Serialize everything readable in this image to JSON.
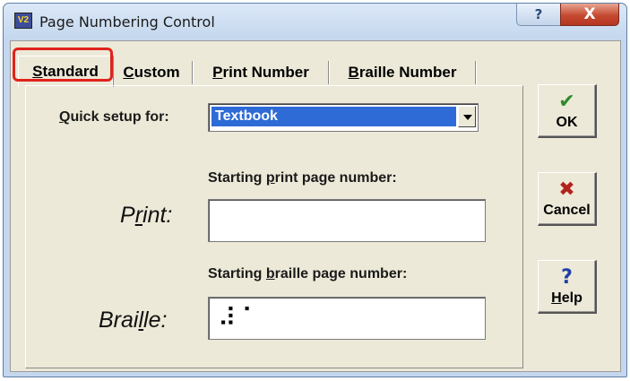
{
  "window": {
    "title": "Page Numbering Control",
    "app_icon": "V2",
    "help_glyph": "?",
    "close_glyph": "X"
  },
  "tabs": [
    {
      "label": "Standard",
      "mnemonic": "S",
      "rest": "tandard",
      "active": true
    },
    {
      "label": "Custom",
      "mnemonic": "C",
      "rest": "ustom",
      "active": false
    },
    {
      "label": "Print Number",
      "mnemonic": "P",
      "rest": "rint Number",
      "active": false
    },
    {
      "label": "Braille Number",
      "mnemonic": "B",
      "rest": "raille Number",
      "active": false
    }
  ],
  "quick_setup": {
    "label_mnemonic": "Q",
    "label_rest": "uick setup for:",
    "selected": "Textbook"
  },
  "print": {
    "heading_pre": "Starting ",
    "heading_mnemonic": "p",
    "heading_post": "rint page number:",
    "label_pre": "P",
    "label_mnemonic": "r",
    "label_post": "int:",
    "value": ""
  },
  "braille": {
    "heading_pre": "Starting ",
    "heading_mnemonic": "b",
    "heading_post": "raille page number:",
    "label_pre": "Brai",
    "label_mnemonic": "l",
    "label_post": "le:",
    "value": "⠼⠁"
  },
  "buttons": {
    "ok": {
      "label": "OK",
      "icon": "check-icon",
      "glyph": "✔",
      "color": "#2f8a2a"
    },
    "cancel": {
      "label": "Cancel",
      "icon": "x-icon",
      "glyph": "✖",
      "color": "#b3231b"
    },
    "help": {
      "mnemonic": "H",
      "rest": "elp",
      "icon": "question-icon",
      "glyph": "?",
      "color": "#1f3fa8"
    }
  },
  "colors": {
    "selection": "#2f6bd6",
    "highlight": "#e0231b"
  }
}
